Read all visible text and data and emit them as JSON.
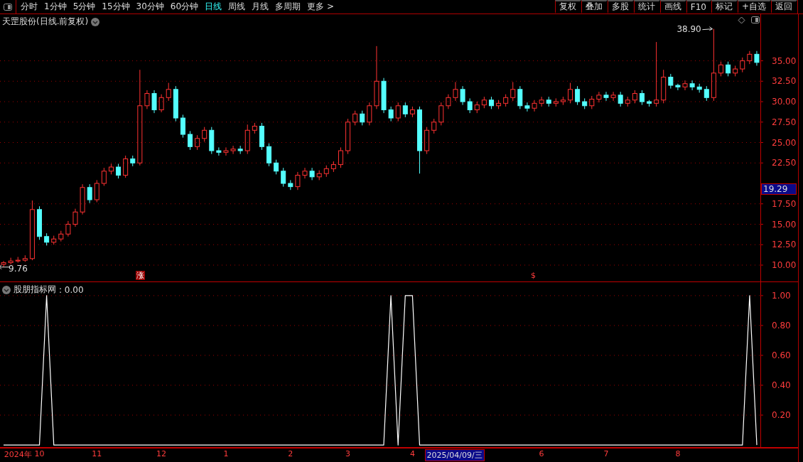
{
  "toolbar": {
    "periods": [
      {
        "label": "分时",
        "selected": false
      },
      {
        "label": "1分钟",
        "selected": false
      },
      {
        "label": "5分钟",
        "selected": false
      },
      {
        "label": "15分钟",
        "selected": false
      },
      {
        "label": "30分钟",
        "selected": false
      },
      {
        "label": "60分钟",
        "selected": false
      },
      {
        "label": "日线",
        "selected": true
      },
      {
        "label": "周线",
        "selected": false
      },
      {
        "label": "月线",
        "selected": false
      },
      {
        "label": "多周期",
        "selected": false
      },
      {
        "label": "更多 >",
        "selected": false
      }
    ],
    "buttons": [
      "复权",
      "叠加",
      "多股",
      "统计",
      "画线",
      "F10",
      "标记",
      "+自选",
      "返回"
    ]
  },
  "price_panel": {
    "title": "天罡股份(日线.前复权)",
    "current_price": "19.29",
    "markers": [
      {
        "kind": "rise",
        "label": "涨"
      },
      {
        "kind": "signal",
        "label": "$"
      }
    ],
    "chart_data": {
      "type": "candlestick",
      "grid": true,
      "ylim": [
        8,
        40.7
      ],
      "yticks": [
        {
          "value": 10,
          "label": "10.00"
        },
        {
          "value": 12.5,
          "label": "12.50"
        },
        {
          "value": 15,
          "label": "15.00"
        },
        {
          "value": 17.5,
          "label": "17.50"
        },
        {
          "value": 22.5,
          "label": "22.50"
        },
        {
          "value": 25,
          "label": "25.00"
        },
        {
          "value": 27.5,
          "label": "27.50"
        },
        {
          "value": 30,
          "label": "30.00"
        },
        {
          "value": 32.5,
          "label": "32.50"
        },
        {
          "value": 35,
          "label": "35.00"
        }
      ],
      "categories": [
        null,
        null,
        null,
        null,
        null,
        null,
        null,
        null,
        null,
        null,
        null,
        null,
        null,
        null,
        null,
        null,
        null,
        null,
        null,
        null,
        null,
        null,
        null,
        null,
        null,
        null,
        null,
        null,
        null,
        null,
        null,
        null,
        null,
        null,
        null,
        null,
        null,
        null,
        null,
        null,
        null,
        null,
        null,
        null,
        null,
        null,
        null,
        null,
        null,
        null,
        null,
        null,
        null,
        null,
        null,
        null,
        null,
        null,
        null,
        null,
        null,
        null,
        null,
        null,
        null,
        null,
        null,
        null,
        null,
        null,
        null,
        null,
        null,
        null,
        null,
        null,
        null,
        null,
        null,
        null,
        null,
        null,
        null,
        null,
        null,
        null,
        null,
        null,
        null,
        null,
        null,
        null,
        null,
        null,
        null,
        null,
        null,
        null,
        null,
        null,
        null,
        null,
        null,
        null,
        null,
        null
      ],
      "ohlc": [
        [
          10.1,
          10.5,
          9.76,
          10.3
        ],
        [
          10.3,
          10.9,
          10.1,
          10.5
        ],
        [
          10.5,
          11,
          10.3,
          10.6
        ],
        [
          10.6,
          11.2,
          10.4,
          10.8
        ],
        [
          10.8,
          17.9,
          10.6,
          16.8
        ],
        [
          16.8,
          17.2,
          13.1,
          13.5
        ],
        [
          13.5,
          13.9,
          12.4,
          12.8
        ],
        [
          12.8,
          13.6,
          12.5,
          13.2
        ],
        [
          13.2,
          14.2,
          12.9,
          13.8
        ],
        [
          13.8,
          15.4,
          13.5,
          15
        ],
        [
          15,
          16.9,
          14.7,
          16.5
        ],
        [
          16.5,
          19.9,
          16.2,
          19.5
        ],
        [
          19.5,
          19.9,
          17.6,
          18
        ],
        [
          18,
          20.4,
          17.7,
          20
        ],
        [
          20,
          21.9,
          19.7,
          21.5
        ],
        [
          21.5,
          22.4,
          21.1,
          22
        ],
        [
          22,
          22.4,
          20.6,
          21
        ],
        [
          21,
          23.4,
          20.7,
          23
        ],
        [
          23,
          23.4,
          22.1,
          22.5
        ],
        [
          22.5,
          33.9,
          22.2,
          29.5
        ],
        [
          29.5,
          31.4,
          29.1,
          31
        ],
        [
          31,
          31.4,
          28.6,
          29
        ],
        [
          29,
          30.9,
          28.7,
          30.5
        ],
        [
          30.5,
          32.3,
          30.1,
          31.5
        ],
        [
          31.5,
          31.9,
          27.6,
          28
        ],
        [
          28,
          28.4,
          25.6,
          26
        ],
        [
          26,
          26.4,
          24.1,
          24.5
        ],
        [
          24.5,
          25.9,
          24.1,
          25.5
        ],
        [
          25.5,
          26.9,
          25.1,
          26.5
        ],
        [
          26.5,
          26.9,
          23.6,
          24
        ],
        [
          24,
          24.4,
          23.4,
          23.8
        ],
        [
          23.8,
          24.4,
          23.4,
          24
        ],
        [
          24,
          24.6,
          23.6,
          24.2
        ],
        [
          24.2,
          24.6,
          23.6,
          24
        ],
        [
          24,
          27.2,
          23.6,
          26.5
        ],
        [
          26.5,
          27.4,
          26.1,
          27
        ],
        [
          27,
          27.4,
          24.1,
          24.5
        ],
        [
          24.5,
          24.9,
          22.1,
          22.5
        ],
        [
          22.5,
          22.9,
          21.1,
          21.5
        ],
        [
          21.5,
          21.9,
          19.6,
          20
        ],
        [
          20,
          20.4,
          19.2,
          19.6
        ],
        [
          19.6,
          21.4,
          19.2,
          21
        ],
        [
          21,
          21.9,
          20.6,
          21.5
        ],
        [
          21.5,
          21.9,
          20.4,
          20.8
        ],
        [
          20.8,
          21.6,
          20.4,
          21.2
        ],
        [
          21.2,
          22.2,
          20.8,
          21.8
        ],
        [
          21.8,
          22.7,
          21.4,
          22.3
        ],
        [
          22.3,
          24.4,
          21.9,
          24
        ],
        [
          24,
          27.9,
          23.6,
          27.5
        ],
        [
          27.5,
          28.9,
          27.1,
          28.5
        ],
        [
          28.5,
          28.9,
          27.1,
          27.5
        ],
        [
          27.5,
          29.9,
          27.1,
          29.5
        ],
        [
          29.5,
          36.8,
          29.1,
          32.5
        ],
        [
          32.5,
          32.9,
          28.6,
          29
        ],
        [
          29,
          29.4,
          27.6,
          28
        ],
        [
          28,
          29.9,
          27.6,
          29.5
        ],
        [
          29.5,
          29.9,
          28.1,
          28.5
        ],
        [
          28.5,
          29.4,
          28.1,
          29
        ],
        [
          29,
          29.4,
          21.2,
          24
        ],
        [
          24,
          26.9,
          23.6,
          26.5
        ],
        [
          26.5,
          27.9,
          26.1,
          27.5
        ],
        [
          27.5,
          29.9,
          27.1,
          29.5
        ],
        [
          29.5,
          30.9,
          29.1,
          30.5
        ],
        [
          30.5,
          32.4,
          30.1,
          31.5
        ],
        [
          31.5,
          31.9,
          29.6,
          30
        ],
        [
          30,
          30.4,
          28.6,
          29
        ],
        [
          29,
          30,
          28.6,
          29.6
        ],
        [
          29.6,
          30.6,
          29.2,
          30.2
        ],
        [
          30.2,
          30.6,
          29.1,
          29.5
        ],
        [
          29.5,
          30.2,
          29.1,
          29.8
        ],
        [
          29.8,
          30.9,
          29.4,
          30.5
        ],
        [
          30.5,
          32.4,
          30.1,
          31.5
        ],
        [
          31.5,
          31.9,
          29.1,
          29.5
        ],
        [
          29.5,
          29.9,
          28.8,
          29.2
        ],
        [
          29.2,
          30.2,
          28.8,
          29.8
        ],
        [
          29.8,
          30.6,
          29.4,
          30.2
        ],
        [
          30.2,
          30.6,
          29.4,
          29.8
        ],
        [
          29.8,
          30.4,
          29.4,
          30
        ],
        [
          30,
          30.6,
          29.6,
          30.2
        ],
        [
          30.2,
          32.3,
          29.8,
          31.5
        ],
        [
          31.5,
          31.9,
          29.6,
          30
        ],
        [
          30,
          30.4,
          29.1,
          29.5
        ],
        [
          29.5,
          30.7,
          29.1,
          30.3
        ],
        [
          30.3,
          31.2,
          29.9,
          30.8
        ],
        [
          30.8,
          31.2,
          30.1,
          30.5
        ],
        [
          30.5,
          31.2,
          30.1,
          30.8
        ],
        [
          30.8,
          31.2,
          29.4,
          29.8
        ],
        [
          29.8,
          30.6,
          29.4,
          30.2
        ],
        [
          30.2,
          31.4,
          29.8,
          31
        ],
        [
          31,
          31.4,
          29.6,
          30
        ],
        [
          30,
          30.2,
          29.4,
          29.8
        ],
        [
          29.8,
          37.3,
          29.4,
          30.2
        ],
        [
          30.2,
          33.9,
          29.8,
          33
        ],
        [
          33,
          33.4,
          31.6,
          32
        ],
        [
          32,
          32.2,
          31.4,
          31.8
        ],
        [
          31.8,
          32.6,
          31.4,
          32.2
        ],
        [
          32.2,
          32.6,
          31.4,
          31.8
        ],
        [
          31.8,
          32.2,
          31.1,
          31.5
        ],
        [
          31.5,
          31.9,
          30.1,
          30.5
        ],
        [
          30.5,
          38.9,
          30.1,
          33.5
        ],
        [
          33.5,
          34.9,
          33.1,
          34.5
        ],
        [
          34.5,
          34.9,
          33.1,
          33.5
        ],
        [
          33.5,
          34.4,
          33.1,
          34
        ],
        [
          34,
          35.4,
          33.6,
          35
        ],
        [
          35,
          36.2,
          34.6,
          35.8
        ],
        [
          35.8,
          36.2,
          34.4,
          34.8
        ]
      ],
      "annotations": [
        "38.90",
        "9.76"
      ]
    }
  },
  "indicator_panel": {
    "reading": ": 0.00",
    "chart_data": {
      "type": "line",
      "grid": true,
      "ylim": [
        -0.014,
        1.09
      ],
      "categories": [
        null,
        null,
        "2024年",
        null,
        null,
        "10",
        null,
        null,
        null,
        null,
        null,
        null,
        null,
        "11",
        null,
        null,
        null,
        null,
        null,
        null,
        null,
        null,
        "12",
        null,
        null,
        null,
        null,
        null,
        null,
        null,
        null,
        "1",
        null,
        null,
        null,
        null,
        null,
        null,
        null,
        null,
        "2",
        null,
        null,
        null,
        null,
        null,
        null,
        null,
        "3",
        null,
        null,
        null,
        null,
        null,
        null,
        null,
        null,
        "4",
        null,
        null,
        null,
        null,
        null,
        null,
        null,
        null,
        null,
        null,
        null,
        null,
        null,
        null,
        null,
        null,
        null,
        "6",
        null,
        null,
        null,
        null,
        null,
        null,
        null,
        null,
        "7",
        null,
        null,
        null,
        null,
        null,
        null,
        null,
        null,
        null,
        "8",
        null,
        null,
        null,
        null,
        null,
        null,
        null,
        null,
        null,
        null,
        null
      ],
      "yticks": [
        {
          "value": 0.2,
          "label": "0.20"
        },
        {
          "value": 0.4,
          "label": "0.40"
        },
        {
          "value": 0.6,
          "label": "0.60"
        },
        {
          "value": 0.8,
          "label": "0.80"
        },
        {
          "value": 1,
          "label": "1.00"
        }
      ],
      "series": [
        {
          "name": "股朋指标网",
          "color": "#ffffff",
          "values": [
            0,
            0,
            0,
            0,
            0,
            0,
            1,
            0,
            0,
            0,
            0,
            0,
            0,
            0,
            0,
            0,
            0,
            0,
            0,
            0,
            0,
            0,
            0,
            0,
            0,
            0,
            0,
            0,
            0,
            0,
            0,
            0,
            0,
            0,
            0,
            0,
            0,
            0,
            0,
            0,
            0,
            0,
            0,
            0,
            0,
            0,
            0,
            0,
            0,
            0,
            0,
            0,
            0,
            0,
            1,
            0,
            1,
            1,
            0,
            0,
            0,
            0,
            0,
            0,
            0,
            0,
            0,
            0,
            0,
            0,
            0,
            0,
            0,
            0,
            0,
            0,
            0,
            0,
            0,
            0,
            0,
            0,
            0,
            0,
            0,
            0,
            0,
            0,
            0,
            0,
            0,
            0,
            0,
            0,
            0,
            0,
            0,
            0,
            0,
            0,
            0,
            0,
            0,
            0,
            1,
            0
          ]
        }
      ]
    }
  },
  "time_axis": {
    "cursor": {
      "label": "2025/04/09/三"
    }
  }
}
